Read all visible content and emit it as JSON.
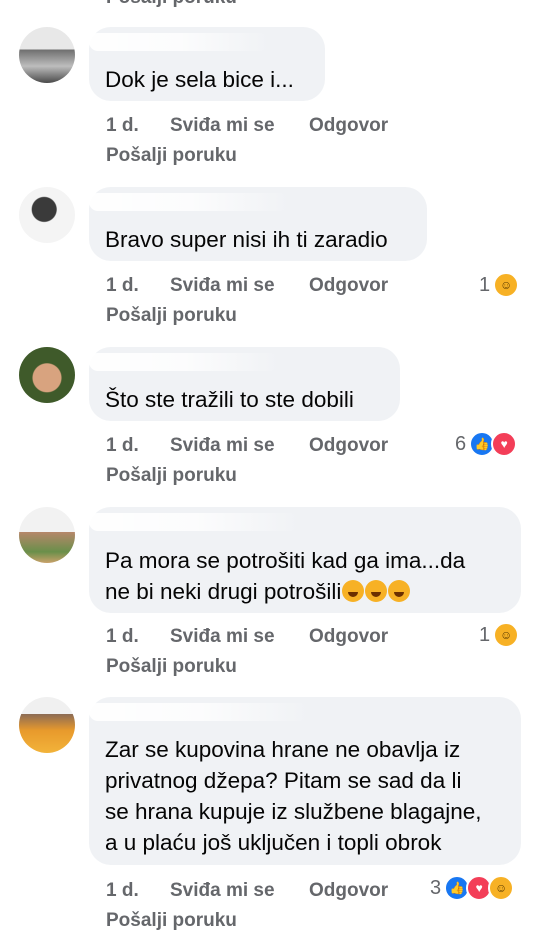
{
  "top_cut_label": "Pošalji poruku",
  "labels": {
    "time": "1 d.",
    "like": "Sviđa mi se",
    "reply": "Odgovor",
    "message": "Pošalji poruku"
  },
  "comments": [
    {
      "text": "Dok je sela bice i...",
      "reaction_count": "",
      "reactions": []
    },
    {
      "text": "Bravo super nisi ih ti zaradio",
      "reaction_count": "1",
      "reactions": [
        "haha-icon"
      ]
    },
    {
      "text": "Što ste tražili to ste dobili",
      "reaction_count": "6",
      "reactions": [
        "like-icon",
        "love-icon"
      ]
    },
    {
      "text": "Pa mora se potrošiti kad ga ima...da\nne bi neki drugi potrošili",
      "reaction_count": "1",
      "reactions": [
        "haha-icon"
      ]
    },
    {
      "text": "Zar se kupovina hrane ne obavlja iz\nprivatnog džepa? Pitam se sad da li\nse hrana kupuje iz službene blagajne,\na u plaću još uključen i topli obrok",
      "reaction_count": "3",
      "reactions": [
        "like-icon",
        "love-icon",
        "haha-icon"
      ]
    }
  ],
  "colors": {
    "bubble": "#f0f2f5",
    "meta_text": "#65676b",
    "body_text": "#050505",
    "like": "#1877f2",
    "love": "#f33e58",
    "haha": "#f7b125"
  }
}
